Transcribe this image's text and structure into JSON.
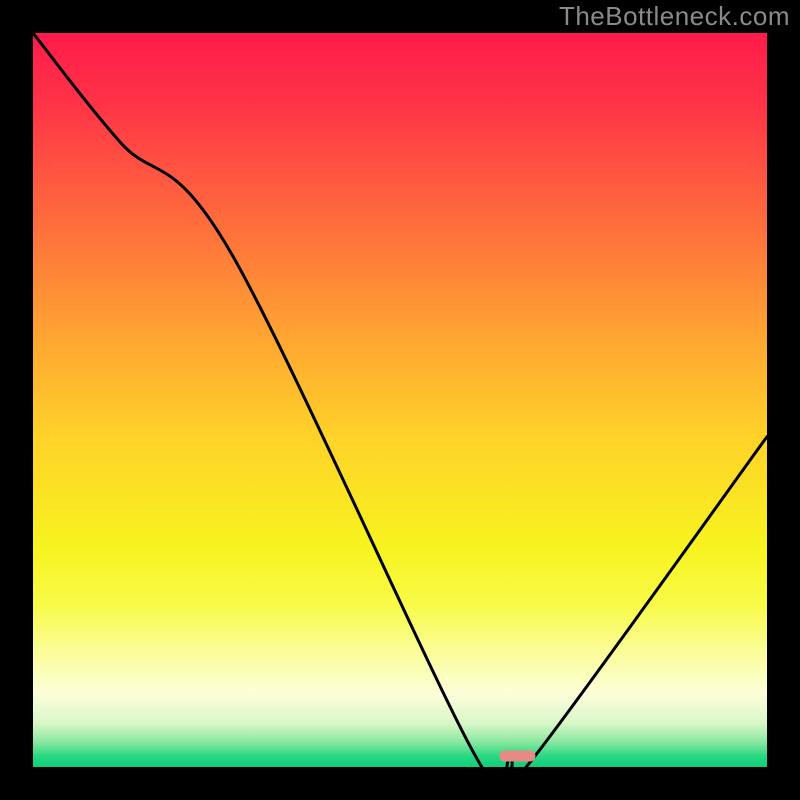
{
  "watermark": "TheBottleneck.com",
  "chart_data": {
    "type": "line",
    "title": "",
    "xlabel": "",
    "ylabel": "",
    "xlim": [
      0,
      100
    ],
    "ylim": [
      0,
      100
    ],
    "grid": false,
    "legend": false,
    "series": [
      {
        "name": "bottleneck-curve",
        "x": [
          0,
          12,
          27,
          60,
          65,
          68,
          100
        ],
        "values": [
          100,
          85,
          70,
          2,
          1,
          1,
          45
        ]
      }
    ],
    "annotations": [
      {
        "name": "optimum-marker",
        "type": "pill",
        "x_center": 66,
        "y": 1.5,
        "color": "#e78a86"
      }
    ],
    "background_gradient": {
      "stops": [
        {
          "offset": 0.0,
          "color": "#ff1b4b"
        },
        {
          "offset": 0.1,
          "color": "#ff3447"
        },
        {
          "offset": 0.25,
          "color": "#ff6a3d"
        },
        {
          "offset": 0.4,
          "color": "#ffa033"
        },
        {
          "offset": 0.55,
          "color": "#ffd229"
        },
        {
          "offset": 0.7,
          "color": "#f7f31f"
        },
        {
          "offset": 0.78,
          "color": "#f8fb49"
        },
        {
          "offset": 0.84,
          "color": "#fbfd95"
        },
        {
          "offset": 0.9,
          "color": "#fdfed9"
        },
        {
          "offset": 0.94,
          "color": "#d9f7c8"
        },
        {
          "offset": 0.965,
          "color": "#8de9a1"
        },
        {
          "offset": 0.985,
          "color": "#2ad783"
        },
        {
          "offset": 1.0,
          "color": "#0fcf79"
        }
      ]
    }
  }
}
